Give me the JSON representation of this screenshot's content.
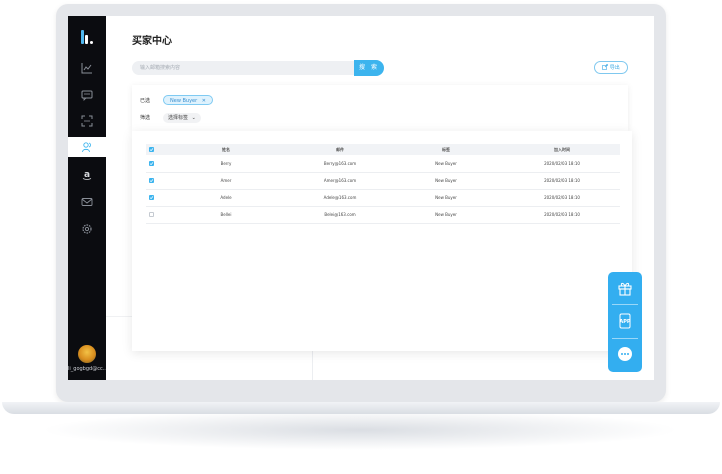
{
  "page": {
    "title": "买家中心"
  },
  "search": {
    "placeholder": "输入邮箱搜索内容",
    "button_label": "搜 索"
  },
  "toolbar": {
    "export_label": "导出"
  },
  "filters": {
    "selected_label": "已选",
    "selected_tag": "New Buyer",
    "filter_label": "筛选",
    "filter_dropdown": "选择标签"
  },
  "table": {
    "columns": [
      "姓名",
      "邮件",
      "标签",
      "加入时间"
    ],
    "rows": [
      {
        "checked": true,
        "name": "Berry",
        "email": "Berry@163.com",
        "tag": "New Buyer",
        "joined": "2020/02/03 18:10"
      },
      {
        "checked": true,
        "name": "Amer",
        "email": "Amer@163.com",
        "tag": "New Buyer",
        "joined": "2020/02/03 18:10"
      },
      {
        "checked": true,
        "name": "Adele",
        "email": "Adele@163.com",
        "tag": "New Buyer",
        "joined": "2020/02/03 18:10"
      },
      {
        "checked": false,
        "name": "Bellei",
        "email": "Belei@163.com",
        "tag": "New Buyer",
        "joined": "2020/02/03 18:10"
      }
    ]
  },
  "sidebar": {
    "items": [
      "chart-icon",
      "message-icon",
      "scan-icon",
      "users-icon",
      "amazon-icon",
      "mail-icon",
      "settings-icon"
    ],
    "active": "users-icon",
    "user": "li_gogbgd@cc..."
  },
  "float_panel": {
    "items": [
      "gift-icon",
      "app-icon",
      "chat-icon"
    ],
    "app_label": "APP"
  },
  "colors": {
    "accent": "#3cb4ee",
    "sidebar": "#0b0c10",
    "tag_bg": "#dff2fd"
  }
}
